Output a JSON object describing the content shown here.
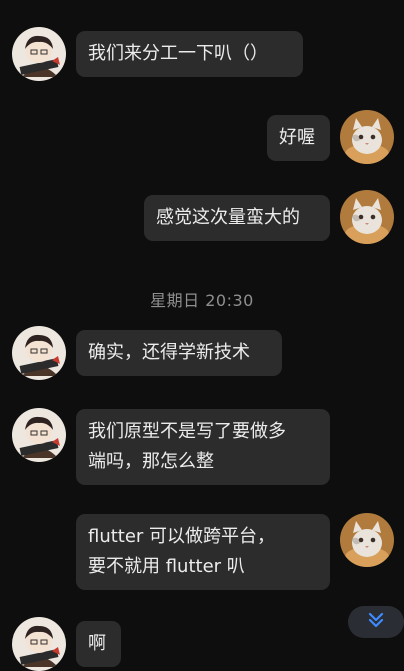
{
  "messages": [
    {
      "side": "left",
      "avatar": "boy-avatar",
      "text": "我们来分工一下叭（）"
    },
    {
      "side": "right",
      "avatar": "cat-avatar",
      "text": "好喔"
    },
    {
      "side": "right",
      "avatar": "cat-avatar",
      "text": "感觉这次量蛮大的"
    },
    {
      "side": "left",
      "avatar": "boy-avatar",
      "text": "确实，还得学新技术"
    },
    {
      "side": "left",
      "avatar": "boy-avatar",
      "text": "我们原型不是写了要做多\n端吗，那怎么整"
    },
    {
      "side": "right",
      "avatar": "cat-avatar",
      "text": "flutter 可以做跨平台，\n要不就用 flutter 叭"
    },
    {
      "side": "left",
      "avatar": "boy-avatar",
      "text": "啊"
    }
  ],
  "timestamp": "星期日 20:30",
  "scroll_down": {
    "icon": "double-chevron-down-icon"
  }
}
